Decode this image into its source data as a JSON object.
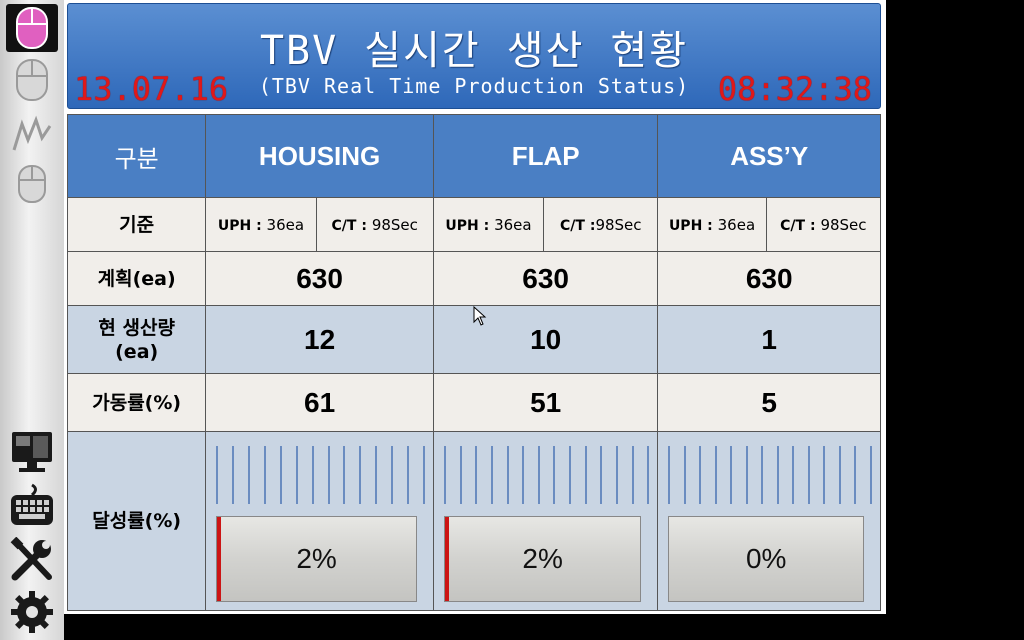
{
  "header": {
    "title": "TBV 실시간 생산 현황",
    "subtitle": "(TBV Real Time Production Status)",
    "date": "13.07.16",
    "time": "08:32:38"
  },
  "table": {
    "corner_label": "구분",
    "columns": [
      "HOUSING",
      "FLAP",
      "ASS’Y"
    ],
    "standard_label": "기준",
    "standards": [
      {
        "uph_label": "UPH : ",
        "uph": "36ea",
        "ct_label": "C/T : ",
        "ct": "98Sec"
      },
      {
        "uph_label": "UPH : ",
        "uph": "36ea",
        "ct_label": "C/T :",
        "ct": "98Sec"
      },
      {
        "uph_label": "UPH : ",
        "uph": "36ea",
        "ct_label": "C/T : ",
        "ct": "98Sec"
      }
    ],
    "plan_label": "계획(ea)",
    "plan": [
      "630",
      "630",
      "630"
    ],
    "production_label_line1": "현 생산량",
    "production_label_line2": "(ea)",
    "production": [
      "12",
      "10",
      "1"
    ],
    "utilization_label": "가동률(%)",
    "utilization": [
      "61",
      "51",
      "5"
    ],
    "achievement_label": "달성률(%)",
    "achievement_text": [
      "2%",
      "2%",
      "0%"
    ],
    "achievement_value": [
      2,
      2,
      0
    ]
  },
  "colors": {
    "header_blue": "#2e68b9",
    "clock_red": "#e01818",
    "progress_red": "#cc1414",
    "row_blue": "#c9d5e3",
    "row_light": "#f1eeea"
  },
  "sidebar": {
    "icons": [
      "mouse-active-icon",
      "mouse-icon",
      "mouse-gesture-icon",
      "mouse-small-icon",
      "monitor-icon",
      "keyboard-icon",
      "tools-icon",
      "gear-icon"
    ]
  }
}
